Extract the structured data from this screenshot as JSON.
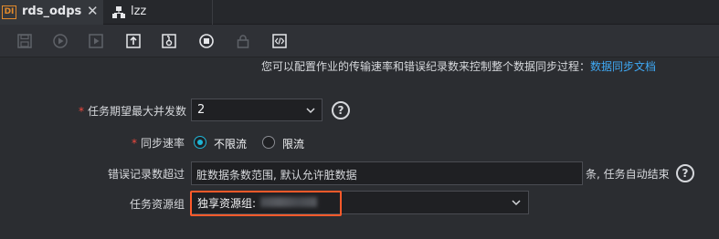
{
  "tabs": [
    {
      "label": "rds_odps",
      "icon": "di-icon",
      "close": "✕"
    },
    {
      "label": "lzz",
      "icon": "hierarchy-icon"
    }
  ],
  "info": {
    "text": "您可以配置作业的传输速率和错误纪录数来控制整个数据同步过程：",
    "link": "数据同步文档"
  },
  "form": {
    "concurrency": {
      "required_mark": "*",
      "label": "任务期望最大并发数",
      "value": "2"
    },
    "rate": {
      "required_mark": "*",
      "label": "同步速率",
      "options": [
        "不限流",
        "限流"
      ],
      "selected": "不限流"
    },
    "error_limit": {
      "label": "错误记录数超过",
      "placeholder": "脏数据条数范围, 默认允许脏数据",
      "suffix": "条, 任务自动结束"
    },
    "resource_group": {
      "label": "任务资源组",
      "value": "独享资源组:"
    }
  },
  "help_glyph": "?",
  "colors": {
    "accent": "#1fb5d6",
    "link": "#3fa9f5",
    "required": "#f0483e",
    "highlight": "#ff5a2a",
    "di": "#e38a2b"
  }
}
